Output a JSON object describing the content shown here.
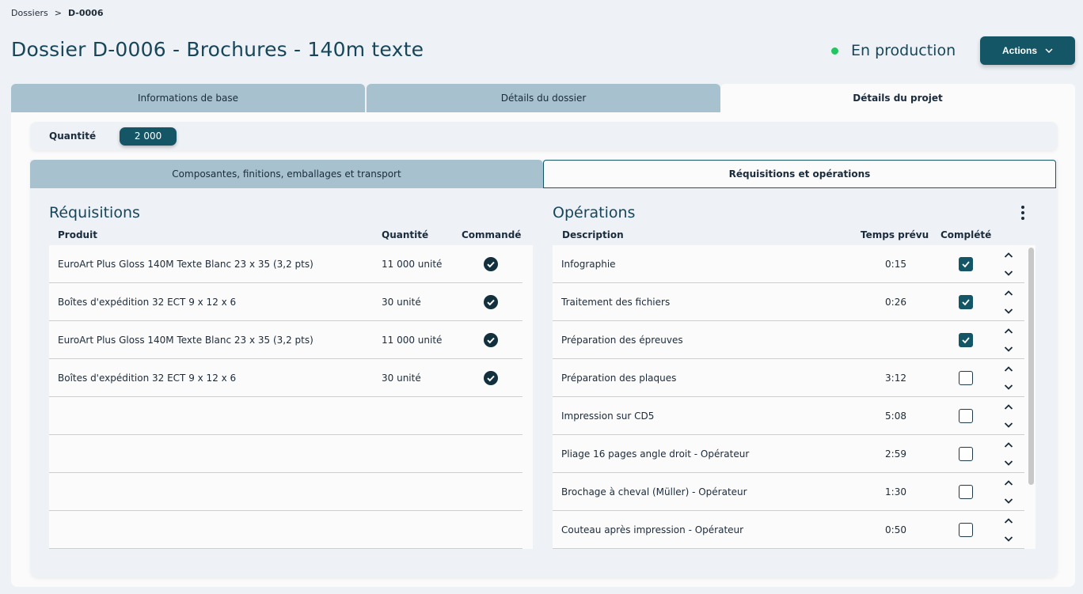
{
  "breadcrumb": {
    "root": "Dossiers",
    "separator": ">",
    "current": "D-0006"
  },
  "header": {
    "title": "Dossier D-0006 - Brochures - 140m texte",
    "status": "En production",
    "status_color": "#22c55e",
    "actions_label": "Actions"
  },
  "tabs": [
    {
      "label": "Informations de base",
      "active": false
    },
    {
      "label": "Détails du dossier",
      "active": false
    },
    {
      "label": "Détails du projet",
      "active": true
    }
  ],
  "quantity": {
    "label": "Quantité",
    "value": "2 000"
  },
  "subtabs": [
    {
      "label": "Composantes, finitions, emballages et transport",
      "active": false
    },
    {
      "label": "Réquisitions et opérations",
      "active": true
    }
  ],
  "requisitions": {
    "title": "Réquisitions",
    "headers": {
      "product": "Produit",
      "quantity": "Quantité",
      "ordered": "Commandé"
    },
    "rows": [
      {
        "product": "EuroArt Plus Gloss 140M Texte Blanc 23 x 35 (3,2 pts)",
        "quantity": "11 000 unité",
        "ordered": true
      },
      {
        "product": "Boîtes d'expédition 32 ECT 9 x 12 x 6",
        "quantity": "30 unité",
        "ordered": true
      },
      {
        "product": "EuroArt Plus Gloss 140M Texte Blanc 23 x 35 (3,2 pts)",
        "quantity": "11 000 unité",
        "ordered": true
      },
      {
        "product": "Boîtes d'expédition 32 ECT 9 x 12 x 6",
        "quantity": "30 unité",
        "ordered": true
      }
    ]
  },
  "operations": {
    "title": "Opérations",
    "headers": {
      "description": "Description",
      "time": "Temps prévu",
      "done": "Complété"
    },
    "rows": [
      {
        "description": "Infographie",
        "time": "0:15",
        "done": true
      },
      {
        "description": "Traitement des fichiers",
        "time": "0:26",
        "done": true
      },
      {
        "description": "Préparation des épreuves",
        "time": "",
        "done": true
      },
      {
        "description": "Préparation des plaques",
        "time": "3:12",
        "done": false
      },
      {
        "description": "Impression sur CD5",
        "time": "5:08",
        "done": false
      },
      {
        "description": "Pliage 16 pages angle droit - Opérateur",
        "time": "2:59",
        "done": false
      },
      {
        "description": "Brochage à cheval (Müller) - Opérateur",
        "time": "1:30",
        "done": false
      },
      {
        "description": "Couteau après impression - Opérateur",
        "time": "0:50",
        "done": false
      }
    ]
  },
  "colors": {
    "primary": "#145566",
    "tab_inactive": "#a7c1cf",
    "title": "#17465a"
  }
}
